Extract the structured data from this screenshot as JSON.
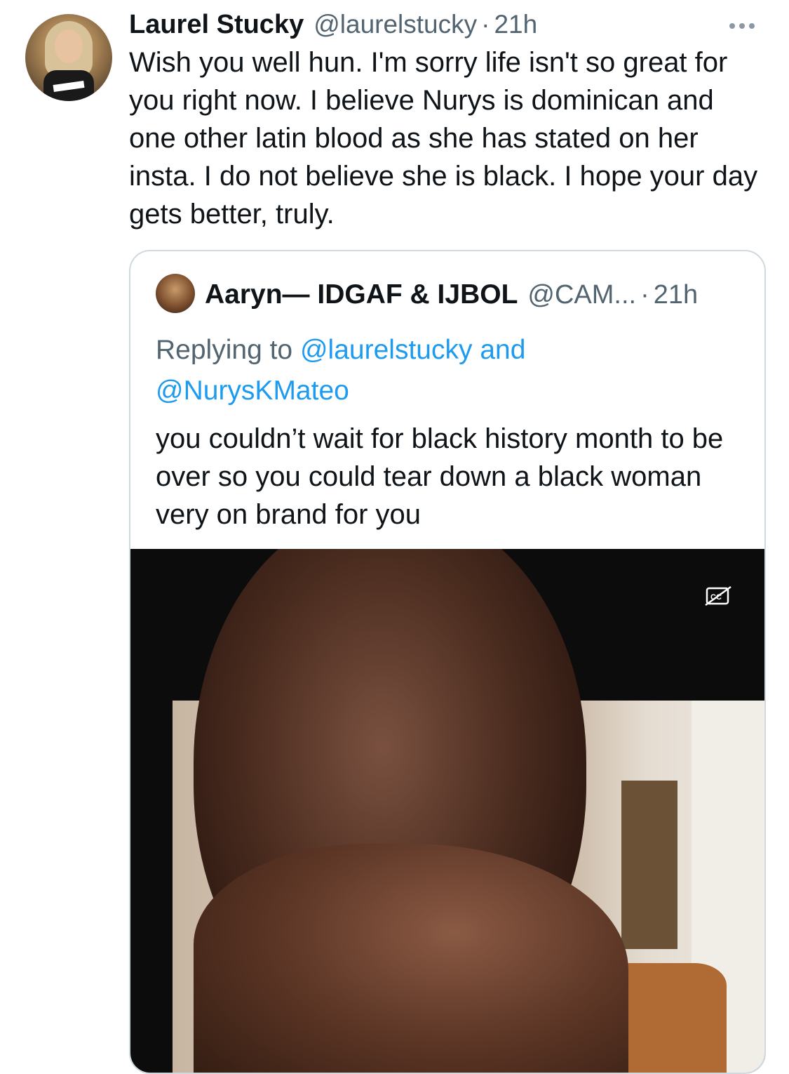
{
  "tweet": {
    "author_name": "Laurel Stucky",
    "author_handle": "@laurelstucky",
    "separator": "·",
    "time": "21h",
    "text": "Wish you well hun. I'm sorry life isn't so great for you right now. I believe Nurys is dominican and one other latin blood as she has stated on her insta. I do not believe she is black. I hope your day gets better, truly."
  },
  "quoted_tweet": {
    "author_name": "Aaryn— IDGAF & IJBOL",
    "author_handle": "@CAM...",
    "separator": "·",
    "time": "21h",
    "replying_prefix": "Replying to",
    "mention_1": "@laurelstucky",
    "joiner": "and",
    "mention_2": "@NurysKMateo",
    "text": "you couldn’t wait for black history month to be over so you could  tear down a black woman very on brand for you"
  },
  "icons": {
    "more": "more-horizontal-icon",
    "captions": "closed-captions-off-icon"
  },
  "colors": {
    "text": "#0f1419",
    "secondary": "#536471",
    "link": "#1d9bf0",
    "border": "#cfd9de"
  }
}
